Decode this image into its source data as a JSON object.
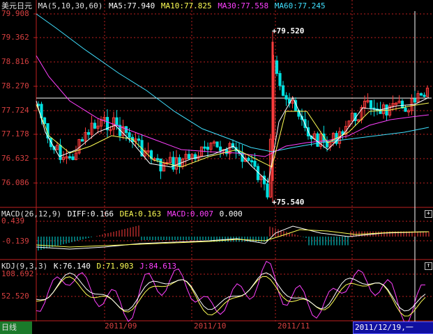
{
  "header": {
    "symbol": "美元日元",
    "ma_params": "MA(5,10,30,60)",
    "ma5": "MA5:77.940",
    "ma10": "MA10:77.825",
    "ma30": "MA30:77.558",
    "ma60": "MA60:77.245"
  },
  "price_axis": [
    "79.908",
    "79.362",
    "78.816",
    "78.270",
    "77.724",
    "77.178",
    "76.632",
    "76.086"
  ],
  "price_annotations": {
    "high": "79.520",
    "low": "75.540"
  },
  "macd": {
    "params": "MACD(26,12,9)",
    "diff": "DIFF:0.166",
    "dea": "DEA:0.163",
    "macd": "MACD:0.007",
    "extra": "0.000",
    "axis": [
      "0.439",
      "-0.139"
    ]
  },
  "kdj": {
    "params": "KDJ(9,3,3)",
    "k": "K:76.140",
    "d": "D:71.903",
    "j": "J:84.613",
    "axis": [
      "108.692",
      "52.520"
    ]
  },
  "x_axis": [
    "2011/09",
    "2011/10",
    "2011/11"
  ],
  "cursor_date": "2011/12/19,一",
  "bottom_tab": "日线",
  "colors": {
    "up": "#ff3c3c",
    "down": "#00e0e0",
    "ma5": "#ffffff",
    "ma10": "#ffff55",
    "ma30": "#ff40ff",
    "ma60": "#40e0ff",
    "grid": "#c02020"
  }
}
